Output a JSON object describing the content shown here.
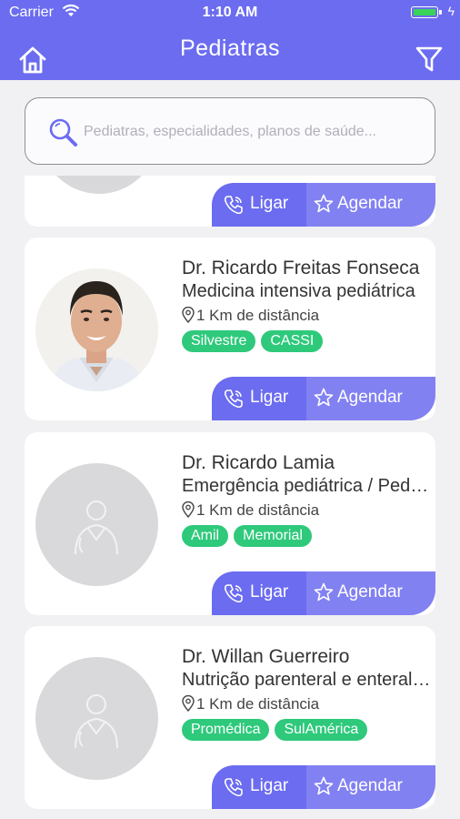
{
  "status_bar": {
    "carrier": "Carrier",
    "time": "1:10 AM"
  },
  "nav": {
    "title": "Pediatras"
  },
  "search": {
    "placeholder": "Pediatras, especialidades, planos de saúde..."
  },
  "actions": {
    "call_label": "Ligar",
    "schedule_label": "Agendar"
  },
  "doctors": [
    {
      "name": "Dr. Ricardo Freitas Fonseca",
      "specialty": "Medicina intensiva pediátrica",
      "distance": "1 Km de distância",
      "plans": [
        "Silvestre",
        "CASSI"
      ]
    },
    {
      "name": "Dr. Ricardo Lamia",
      "specialty": "Emergência pediátrica / Pediatria",
      "distance": "1 Km de distância",
      "plans": [
        "Amil",
        "Memorial"
      ]
    },
    {
      "name": "Dr. Willan Guerreiro",
      "specialty": "Nutrição parenteral e enteral pediátrica",
      "distance": "1 Km de distância",
      "plans": [
        "Promédica",
        "SulAmérica"
      ]
    }
  ]
}
